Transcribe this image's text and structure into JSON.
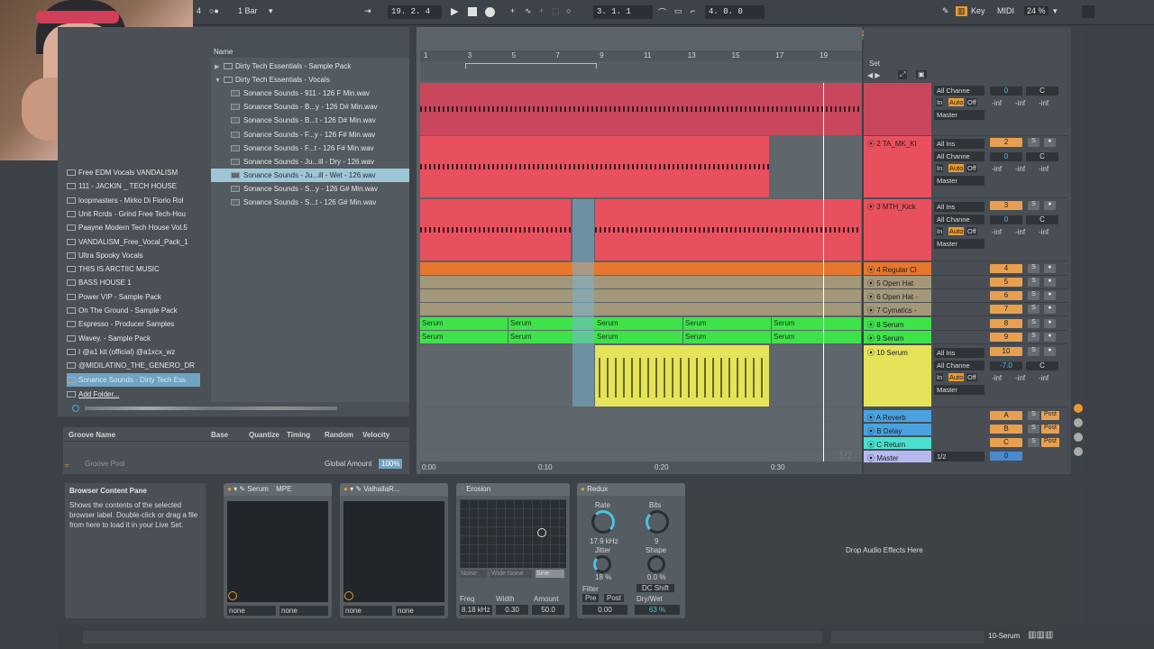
{
  "transport": {
    "quant": "1 Bar",
    "left_num": "4",
    "position": "19.  2.  4",
    "loop_start": "3.  1.  1",
    "loop_len": "4.  0.  0",
    "key_label": "Key",
    "midi_label": "MIDI",
    "cpu": "24 %"
  },
  "browser": {
    "column_header": "Name",
    "tree": [
      {
        "label": "Dirty Tech Essentials - Sample Pack",
        "type": "folder",
        "arrow": "▶"
      },
      {
        "label": "Dirty Tech Essentials - Vocals",
        "type": "folder",
        "arrow": "▼"
      },
      {
        "label": "Sonance Sounds - 911 - 126 F Min.wav",
        "type": "wav"
      },
      {
        "label": "Sonance Sounds - B...y - 126 D# Min.wav",
        "type": "wav"
      },
      {
        "label": "Sonance Sounds - B...t - 126 D# Min.wav",
        "type": "wav"
      },
      {
        "label": "Sonance Sounds - F...y - 126 F# Min.wav",
        "type": "wav"
      },
      {
        "label": "Sonance Sounds - F...t - 126 F# Min.wav",
        "type": "wav"
      },
      {
        "label": "Sonance Sounds - Ju...ill - Dry - 126.wav",
        "type": "wav"
      },
      {
        "label": "Sonance Sounds - Ju...ill - Wet - 126.wav",
        "type": "wav",
        "selected": true
      },
      {
        "label": "Sonance Sounds - S...y - 126 G# Min.wav",
        "type": "wav"
      },
      {
        "label": "Sonance Sounds - S...t - 126 G# Min.wav",
        "type": "wav"
      }
    ],
    "places": [
      "Free EDM Vocals VANDALISM",
      "111 - JACKIN _ TECH HOUSE",
      "loopmasters - Mirko Di Florio Rol",
      "Unit Rcrds - Grind Free Tech-Hou",
      "Paayne Modern Tech House Vol.5",
      "VANDALISM_Free_Vocal_Pack_1",
      "Ultra Spooky Vocals",
      "THIS IS ARCTIIC MUSIC",
      "BASS HOUSE 1",
      "Power VIP - Sample Pack",
      "On The Ground - Sample Pack",
      "Espresso - Producer Samples",
      "Wavey. - Sample Pack",
      "I @a1 kit (official) @a1xcx_wz",
      "@MIDILATINO_THE_GENERO_DR",
      "Sonance Sounds - Dirty Tech Ess"
    ],
    "add_folder": "Add Folder..."
  },
  "groove": {
    "headers": [
      "Groove Name",
      "Base",
      "Quantize",
      "Timing",
      "Random",
      "Velocity"
    ],
    "pool": "Groove Pool",
    "global_label": "Global Amount",
    "global_value": "100%"
  },
  "ruler": {
    "bars": [
      "1",
      "3",
      "5",
      "7",
      "9",
      "11",
      "13",
      "15",
      "17",
      "19"
    ],
    "times": [
      "0:00",
      "0:10",
      "0:20",
      "0:30"
    ],
    "set_label": "Set",
    "page": "1/2"
  },
  "tracks": [
    {
      "name": "",
      "color": "#c8475c",
      "num": "",
      "input": "All Channe",
      "auto": "Auto",
      "off": "Off",
      "out": "Master",
      "vol": "0",
      "pan": "C"
    },
    {
      "name": "2 TA_MK_KI",
      "color": "#e8505e",
      "num": "2",
      "input": "All Ins",
      "channel": "All Channe",
      "vol": "0",
      "pan": "C",
      "out": "Master"
    },
    {
      "name": "3 MTH_Kick",
      "color": "#e8505e",
      "num": "3",
      "input": "All Ins",
      "channel": "All Channe",
      "vol": "0",
      "pan": "C",
      "out": "Master"
    },
    {
      "name": "4 Regular Cl",
      "color": "#e8772e",
      "num": "4"
    },
    {
      "name": "5 Open Hat",
      "color": "#a3987a",
      "num": "5"
    },
    {
      "name": "6 Open Hat -",
      "color": "#a3987a",
      "num": "6"
    },
    {
      "name": "7 Cymatics -",
      "color": "#a3987a",
      "num": "7"
    },
    {
      "name": "8 Serum",
      "color": "#3ee34a",
      "num": "8"
    },
    {
      "name": "9 Serum",
      "color": "#3ee34a",
      "num": "9"
    },
    {
      "name": "10 Serum",
      "color": "#e5e35a",
      "num": "10",
      "input": "All Ins",
      "channel": "All Channe",
      "vol": "-7.0",
      "pan": "C",
      "out": "Master"
    }
  ],
  "returns": [
    {
      "name": "A Reverb",
      "letter": "A",
      "color": "#4aa3e0"
    },
    {
      "name": "B Delay",
      "letter": "B",
      "color": "#4aa3e0"
    },
    {
      "name": "C Return",
      "letter": "C",
      "color": "#4ae0d0"
    },
    {
      "name": "Master",
      "letter": "0",
      "color": "#b8b8f0",
      "out": "1/2"
    }
  ],
  "clips": {
    "serum_label": "Serum"
  },
  "mixer_labels": {
    "in": "In",
    "auto": "Auto",
    "off": "Off",
    "s": "S",
    "inf": "-inf",
    "post": "Post"
  },
  "devices": {
    "info_title": "Browser Content Pane",
    "info_text": "Shows the contents of the selected browser label. Double-click or drag a file from here to load it in your Live Set.",
    "serum": {
      "title": "Serum",
      "mpe": "MPE",
      "sel1": "none",
      "sel2": "none"
    },
    "valhalla": {
      "title": "ValhallaR...",
      "sel1": "none",
      "sel2": "none"
    },
    "erosion": {
      "title": "Erosion",
      "modes": [
        "Noise",
        "Wide Noise",
        "Sine"
      ],
      "freq_label": "Freq",
      "freq": "8.18 kHz",
      "width_label": "Width",
      "width": "0.30",
      "amount_label": "Amount",
      "amount": "50.0"
    },
    "redux": {
      "title": "Redux",
      "rate_label": "Rate",
      "rate": "17.9 kHz",
      "bits_label": "Bits",
      "bits": "9",
      "jitter_label": "Jitter",
      "jitter": "18 %",
      "shape_label": "Shape",
      "shape": "0.0 %",
      "filter_label": "Filter",
      "pre": "Pre",
      "post": "Post",
      "dc": "DC Shift",
      "filter_val": "0.00",
      "drywet_label": "Dry/Wet",
      "drywet": "63 %"
    },
    "drop": "Drop Audio Effects Here"
  },
  "status": {
    "track": "10-Serum"
  }
}
